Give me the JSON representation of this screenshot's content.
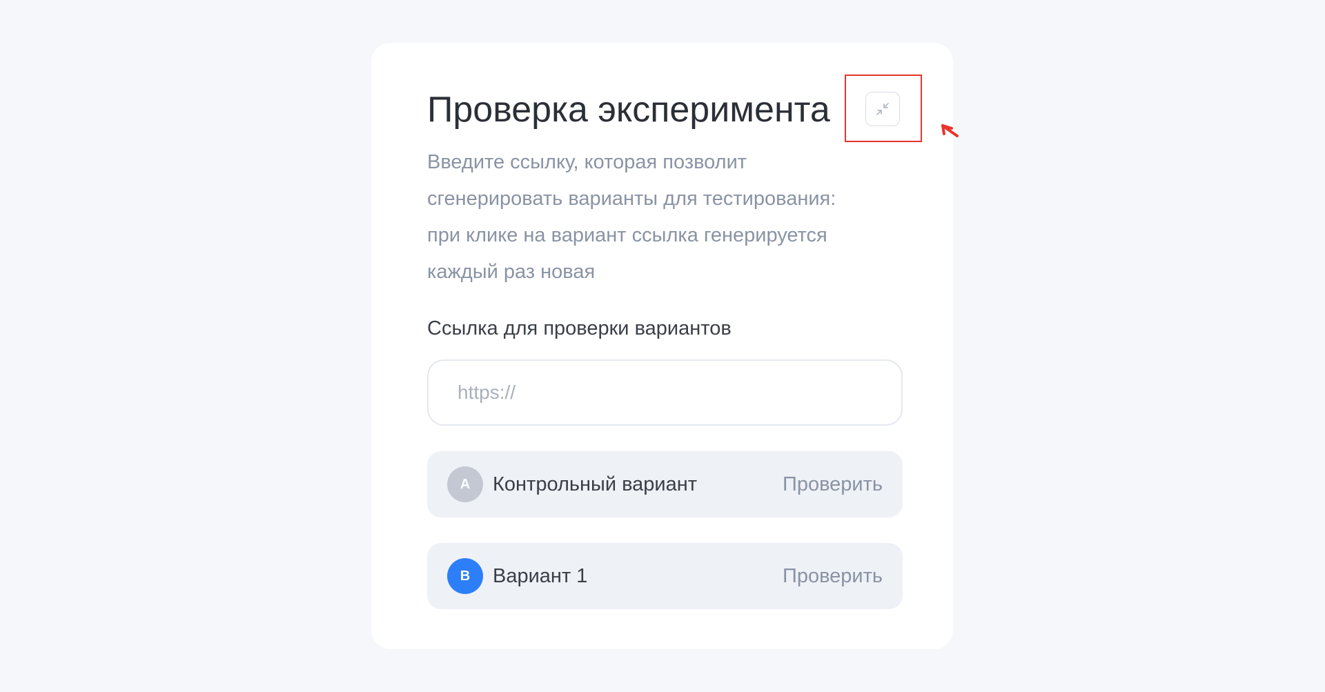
{
  "card": {
    "title": "Проверка эксперимента",
    "description": "Введите ссылку, которая позволит\nсгенерировать варианты для тестирования:\nпри клике на вариант ссылка генерируется\nкаждый раз новая",
    "collapse_icon": "collapse-arrows-icon"
  },
  "form": {
    "label": "Ссылка для проверки вариантов",
    "placeholder": "https://",
    "value": ""
  },
  "variants": [
    {
      "badge": "A",
      "name": "Контрольный вариант",
      "action": "Проверить",
      "badge_color": "#c3c8d2"
    },
    {
      "badge": "B",
      "name": "Вариант 1",
      "action": "Проверить",
      "badge_color": "#2d7ff9"
    }
  ],
  "colors": {
    "background": "#f5f7fa",
    "card": "#ffffff",
    "title": "#2b2f36",
    "muted_text": "#8a93a4",
    "variant_background": "#eef1f6",
    "highlight_annotation": "#e8342b"
  }
}
